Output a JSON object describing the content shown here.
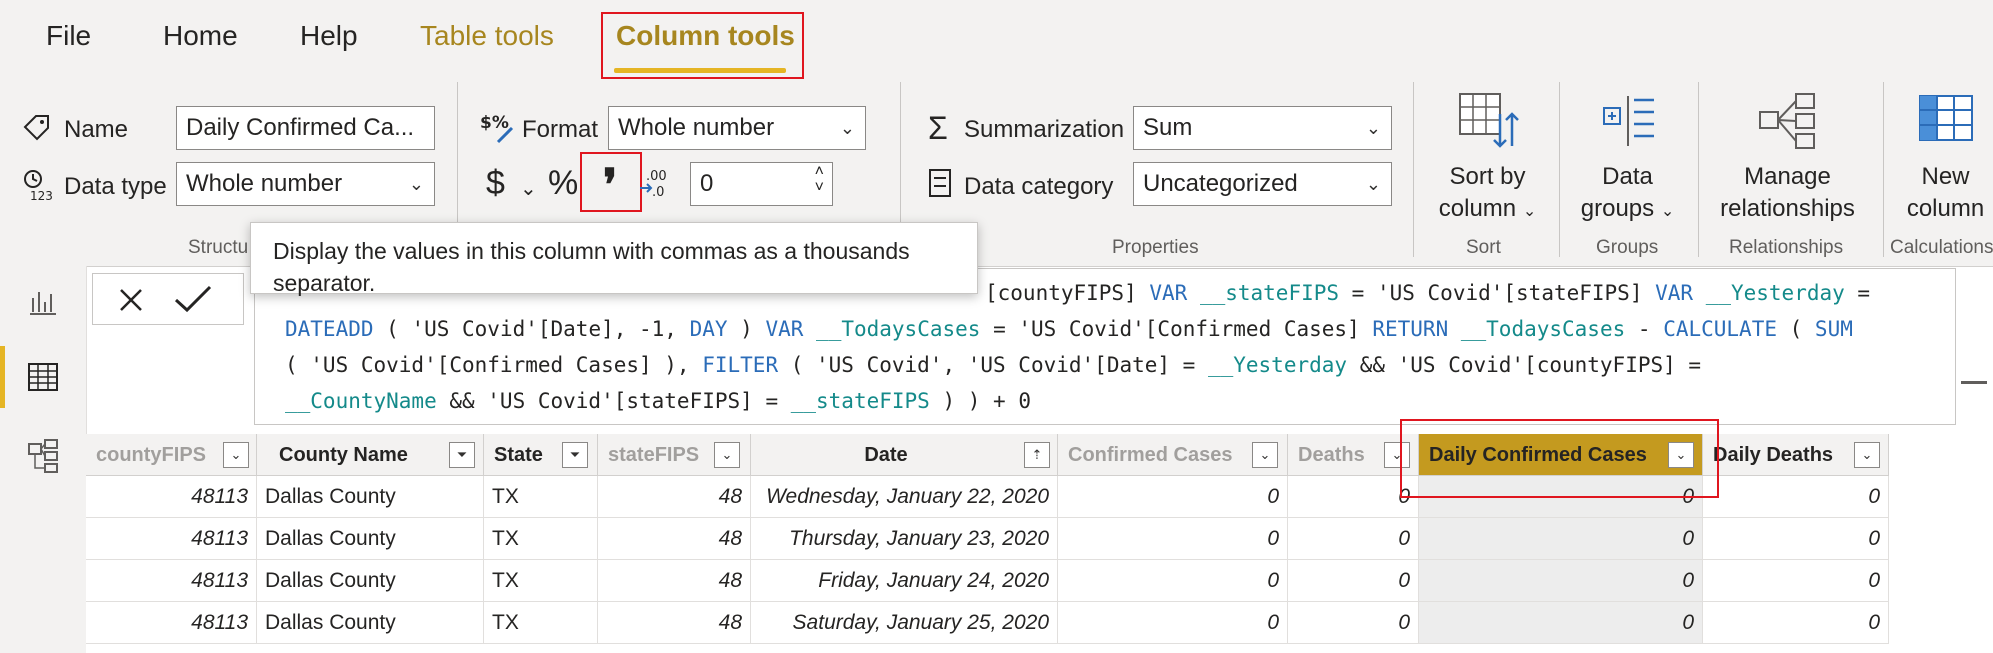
{
  "tabs": [
    "File",
    "Home",
    "Help",
    "Table tools",
    "Column tools"
  ],
  "structure": {
    "name_label": "Name",
    "name_value": "Daily Confirmed Ca...",
    "datatype_label": "Data type",
    "datatype_value": "Whole number",
    "group_label": "Structu"
  },
  "formatting": {
    "format_label": "Format",
    "format_value": "Whole number",
    "currency_symbol": "$",
    "percent_symbol": "%",
    "comma_symbol": "❜",
    "decimal_value": "0"
  },
  "properties": {
    "summarization_label": "Summarization",
    "summarization_value": "Sum",
    "datacategory_label": "Data category",
    "datacategory_value": "Uncategorized",
    "group_label": "Properties"
  },
  "sort": {
    "button_line1": "Sort by",
    "button_line2": "column",
    "group_label": "Sort"
  },
  "groups": {
    "button_line1": "Data",
    "button_line2": "groups",
    "group_label": "Groups"
  },
  "relationships": {
    "button_line1": "Manage",
    "button_line2": "relationships",
    "group_label": "Relationships"
  },
  "calculations": {
    "button_line1": "New",
    "button_line2": "column",
    "group_label": "Calculations"
  },
  "tooltip": {
    "line1": "Display the values in this column with commas as a thousands",
    "line2": "separator."
  },
  "formula_lines": [
    [
      {
        "t": "[countyFIPS] ",
        "c": ""
      },
      {
        "t": "VAR ",
        "c": "kw"
      },
      {
        "t": "__stateFIPS",
        "c": "var"
      },
      {
        "t": " = 'US Covid'[stateFIPS] ",
        "c": ""
      },
      {
        "t": "VAR ",
        "c": "kw"
      },
      {
        "t": "__Yesterday",
        "c": "var"
      },
      {
        "t": " =",
        "c": ""
      }
    ],
    [
      {
        "t": "DATEADD",
        "c": "kw"
      },
      {
        "t": " ( 'US Covid'[Date], -1, ",
        "c": ""
      },
      {
        "t": "DAY",
        "c": "kw"
      },
      {
        "t": " ) ",
        "c": ""
      },
      {
        "t": "VAR ",
        "c": "kw"
      },
      {
        "t": "__TodaysCases",
        "c": "var"
      },
      {
        "t": " = 'US Covid'[Confirmed Cases] ",
        "c": ""
      },
      {
        "t": "RETURN ",
        "c": "kw"
      },
      {
        "t": "__TodaysCases",
        "c": "var"
      },
      {
        "t": " - ",
        "c": ""
      },
      {
        "t": "CALCULATE",
        "c": "kw"
      },
      {
        "t": " ( ",
        "c": ""
      },
      {
        "t": "SUM",
        "c": "kw"
      }
    ],
    [
      {
        "t": "( 'US Covid'[Confirmed Cases] ), ",
        "c": ""
      },
      {
        "t": "FILTER",
        "c": "kw"
      },
      {
        "t": " ( 'US Covid', 'US Covid'[Date] = ",
        "c": ""
      },
      {
        "t": "__Yesterday",
        "c": "var"
      },
      {
        "t": " && 'US Covid'[countyFIPS] =",
        "c": ""
      }
    ],
    [
      {
        "t": "__CountyName",
        "c": "var"
      },
      {
        "t": " && 'US Covid'[stateFIPS] = ",
        "c": ""
      },
      {
        "t": "__stateFIPS",
        "c": "var"
      },
      {
        "t": " ) ) + 0",
        "c": ""
      }
    ]
  ],
  "table": {
    "columns": [
      "countyFIPS",
      "County Name",
      "State",
      "stateFIPS",
      "Date",
      "Confirmed Cases",
      "Deaths",
      "Daily Confirmed Cases",
      "Daily Deaths"
    ],
    "rows": [
      [
        "48113",
        "Dallas County",
        "TX",
        "48",
        "Wednesday, January 22, 2020",
        "0",
        "0",
        "0",
        "0"
      ],
      [
        "48113",
        "Dallas County",
        "TX",
        "48",
        "Thursday, January 23, 2020",
        "0",
        "0",
        "0",
        "0"
      ],
      [
        "48113",
        "Dallas County",
        "TX",
        "48",
        "Friday, January 24, 2020",
        "0",
        "0",
        "0",
        "0"
      ],
      [
        "48113",
        "Dallas County",
        "TX",
        "48",
        "Saturday, January 25, 2020",
        "0",
        "0",
        "0",
        "0"
      ]
    ]
  },
  "colors": {
    "accent": "#e5b524",
    "selected_header": "#c49a1f",
    "highlight_box": "#e0161f",
    "dax_keyword": "#2b6cb8",
    "dax_variable": "#148a8a"
  }
}
